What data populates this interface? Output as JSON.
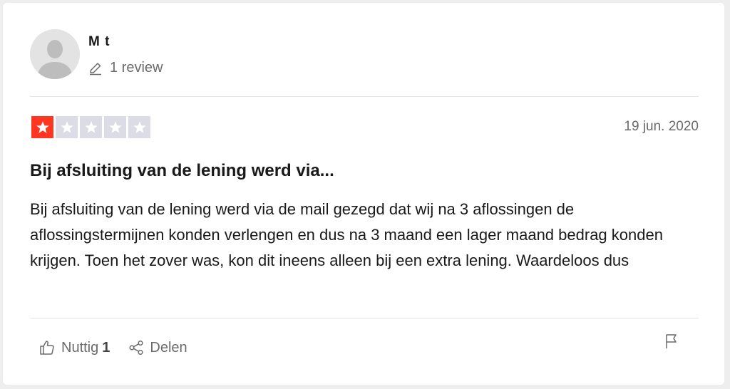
{
  "reviewer": {
    "name": "M t",
    "review_count": "1 review"
  },
  "rating": {
    "stars": 1,
    "max": 5,
    "filled_color": "#ff3722",
    "empty_color": "#dcdce6"
  },
  "review": {
    "date": "19 jun. 2020",
    "title": "Bij afsluiting van de lening werd via...",
    "body": "Bij afsluiting van de lening werd via de mail gezegd dat wij na 3 aflossingen de aflossingstermijnen konden verlengen en dus na 3 maand een lager maand bedrag konden krijgen. Toen het zover was, kon dit ineens alleen bij een extra lening. Waardeloos dus"
  },
  "actions": {
    "useful_label": "Nuttig",
    "useful_count": "1",
    "share_label": "Delen"
  },
  "icons": {
    "avatar": "person-silhouette-icon",
    "review_count": "pencil-icon",
    "useful": "thumbs-up-icon",
    "share": "share-icon",
    "report": "flag-icon",
    "star": "star-icon"
  }
}
